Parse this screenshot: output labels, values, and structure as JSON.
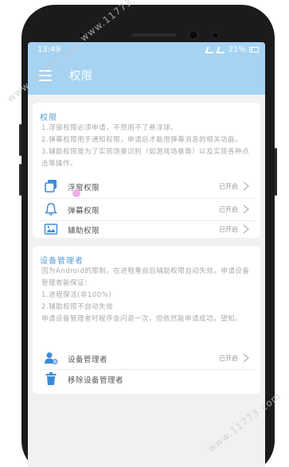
{
  "status_bar": {
    "time": "13:49",
    "battery": "21%"
  },
  "app_bar": {
    "title": "权限"
  },
  "permissions": {
    "title": "权限",
    "notes": [
      "1.浮窗权限必须申请，不然用不了悬浮球。",
      "2.弹幕权限用于通知权限，申请后才能用弹幕消息的相关功能。",
      "3.辅助权限是为了实现场景识别（如游戏场景等）以及实现各种点击等操作。"
    ],
    "items": [
      {
        "label": "浮窗权限",
        "status": "已开启",
        "icon": "window-stack-icon"
      },
      {
        "label": "弹幕权限",
        "status": "已开启",
        "icon": "bell-icon"
      },
      {
        "label": "辅助权限",
        "status": "已开启",
        "icon": "picture-frame-icon"
      }
    ]
  },
  "device_admin": {
    "title": "设备管理者",
    "notes": [
      "因为Android的限制，在进程重启后辅助权限自动失效。申请设备管理者能保证：",
      "1.进程保活(非100%)",
      "2.辅助权限不自动失效",
      "申请设备管理者时程序会闪退一次，但依然能申请成功，望知。"
    ],
    "items": [
      {
        "label": "设备管理者",
        "status": "已开启",
        "icon": "user-gear-icon"
      },
      {
        "label": "移除设备管理者",
        "status": "",
        "icon": "trash-icon"
      }
    ]
  },
  "watermarks": [
    "www.11773.com",
    "www.11773.com",
    "www.11773.com"
  ],
  "colors": {
    "accent": "#a7d3f2",
    "section_title": "#5aa0d6",
    "icon_blue": "#3d8bd8"
  }
}
